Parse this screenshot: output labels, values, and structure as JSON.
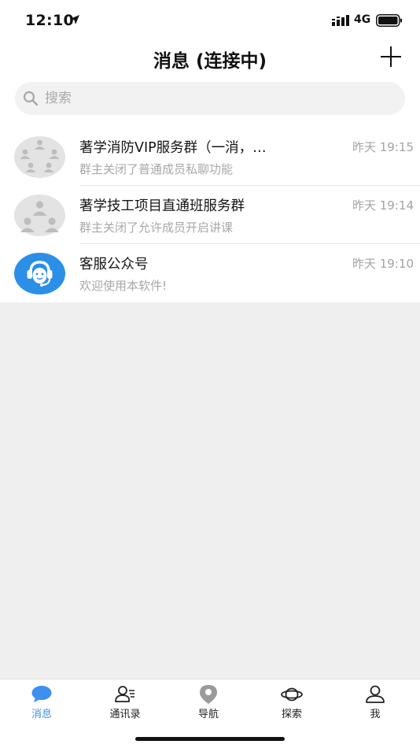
{
  "status_bar": {
    "time": "12:10",
    "network": "4G"
  },
  "header": {
    "title": "消息 (连接中)"
  },
  "search": {
    "placeholder": "搜索"
  },
  "conversations": [
    {
      "name": "著学消防VIP服务群（一消，…",
      "time": "昨天 19:15",
      "preview": "群主关闭了普通成员私聊功能",
      "avatar": "group-avatar-icon"
    },
    {
      "name": "著学技工项目直通班服务群",
      "time": "昨天 19:14",
      "preview": "群主关闭了允许成员开启讲课",
      "avatar": "group-avatar-icon"
    },
    {
      "name": "客服公众号",
      "time": "昨天 19:10",
      "preview": "欢迎使用本软件!",
      "avatar": "customer-service-icon"
    }
  ],
  "tabs": [
    {
      "label": "消息",
      "icon": "chat-bubble-icon",
      "active": true
    },
    {
      "label": "通讯录",
      "icon": "contacts-icon",
      "active": false
    },
    {
      "label": "导航",
      "icon": "map-pin-icon",
      "active": false
    },
    {
      "label": "探索",
      "icon": "planet-icon",
      "active": false
    },
    {
      "label": "我",
      "icon": "person-icon",
      "active": false
    }
  ],
  "colors": {
    "accent": "#3d8ff0",
    "background": "#efefef",
    "secondary_text": "#a8a8a8"
  }
}
